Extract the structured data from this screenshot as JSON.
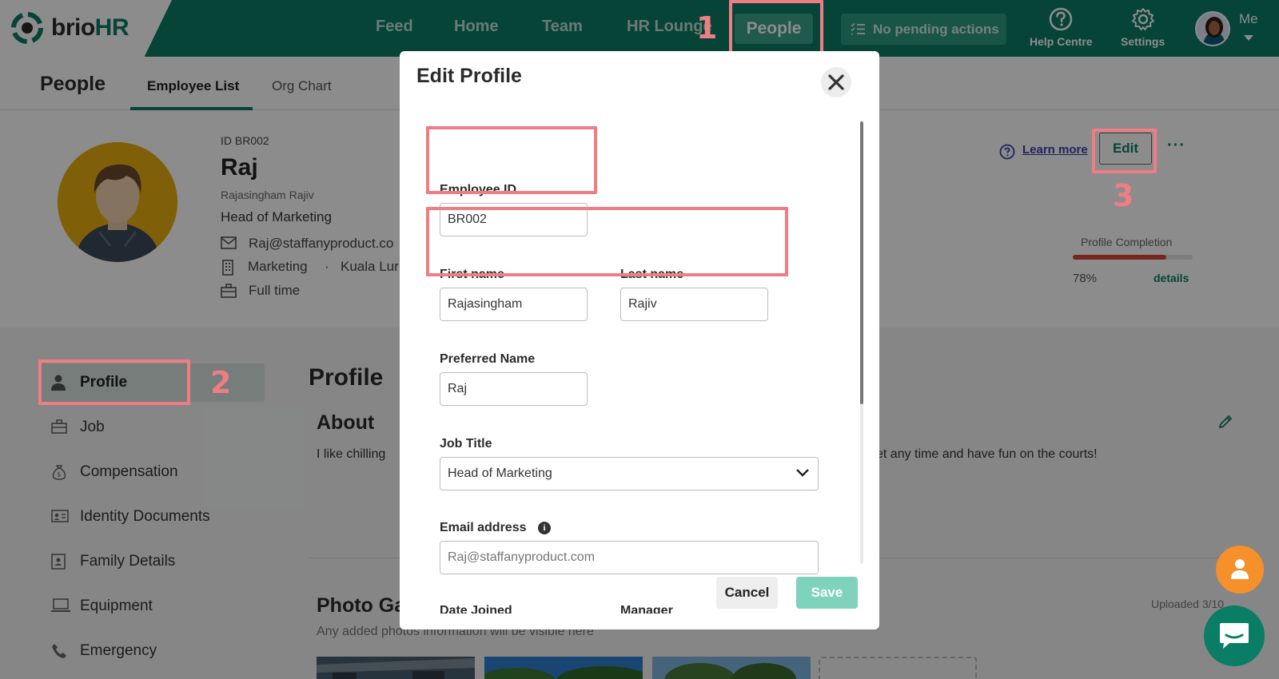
{
  "app": {
    "brand": {
      "brio": "brio",
      "hr": "HR"
    },
    "nav": [
      "Feed",
      "Home",
      "Team",
      "HR Lounge",
      "People"
    ],
    "pending_actions": "No pending actions",
    "help_centre": "Help Centre",
    "settings": "Settings",
    "me": "Me"
  },
  "subheader": {
    "title": "People",
    "tabs": [
      "Employee List",
      "Org Chart"
    ],
    "active_tab": "Employee List"
  },
  "employee": {
    "id_label": "ID BR002",
    "name": "Raj",
    "full_name": "Rajasingham Rajiv",
    "job_title": "Head of Marketing",
    "email": "Raj@staffanyproduct.co",
    "department": "Marketing",
    "separator": "·",
    "location": "Kuala Lur",
    "employment_type": "Full time"
  },
  "header_actions": {
    "learn_more": "Learn more",
    "edit": "Edit",
    "more": "···"
  },
  "profile_completion": {
    "label": "Profile Completion",
    "percent": 78,
    "percent_text": "78%",
    "details": "details",
    "color": "#d9453a"
  },
  "sidebar": {
    "items": [
      {
        "label": "Profile",
        "icon": "person-icon"
      },
      {
        "label": "Job",
        "icon": "briefcase-icon"
      },
      {
        "label": "Compensation",
        "icon": "money-bag-icon"
      },
      {
        "label": "Identity Documents",
        "icon": "id-card-icon"
      },
      {
        "label": "Family Details",
        "icon": "contact-book-icon"
      },
      {
        "label": "Equipment",
        "icon": "laptop-icon"
      },
      {
        "label": "Emergency",
        "icon": "phone-icon"
      }
    ]
  },
  "main": {
    "heading": "Profile",
    "about_heading": "About",
    "about_text_left": "I like chilling",
    "about_text_right": "et any time and have fun on the courts!",
    "photo_heading": "Photo Ga",
    "photo_subtext": "Any added photos information will be visible here",
    "uploaded": "Uploaded 3/10"
  },
  "modal": {
    "title": "Edit Profile",
    "fields": {
      "employee_id": {
        "label": "Employee ID",
        "value": "BR002"
      },
      "first_name": {
        "label": "First name",
        "value": "Rajasingham"
      },
      "last_name": {
        "label": "Last name",
        "value": "Rajiv"
      },
      "preferred_name": {
        "label": "Preferred Name",
        "value": "Raj"
      },
      "job_title": {
        "label": "Job Title",
        "value": "Head of Marketing"
      },
      "email": {
        "label": "Email address",
        "placeholder": "Raj@staffanyproduct.com"
      },
      "date_joined": {
        "label": "Date Joined"
      },
      "manager": {
        "label": "Manager"
      }
    },
    "info_glyph": "i",
    "cancel": "Cancel",
    "save": "Save"
  },
  "steps": [
    "1",
    "2",
    "3"
  ],
  "colors": {
    "brand_green": "#0a7d65",
    "highlight": "#ef7d83",
    "save_disabled": "#7fd3bd",
    "fab_orange": "#f5902b"
  }
}
